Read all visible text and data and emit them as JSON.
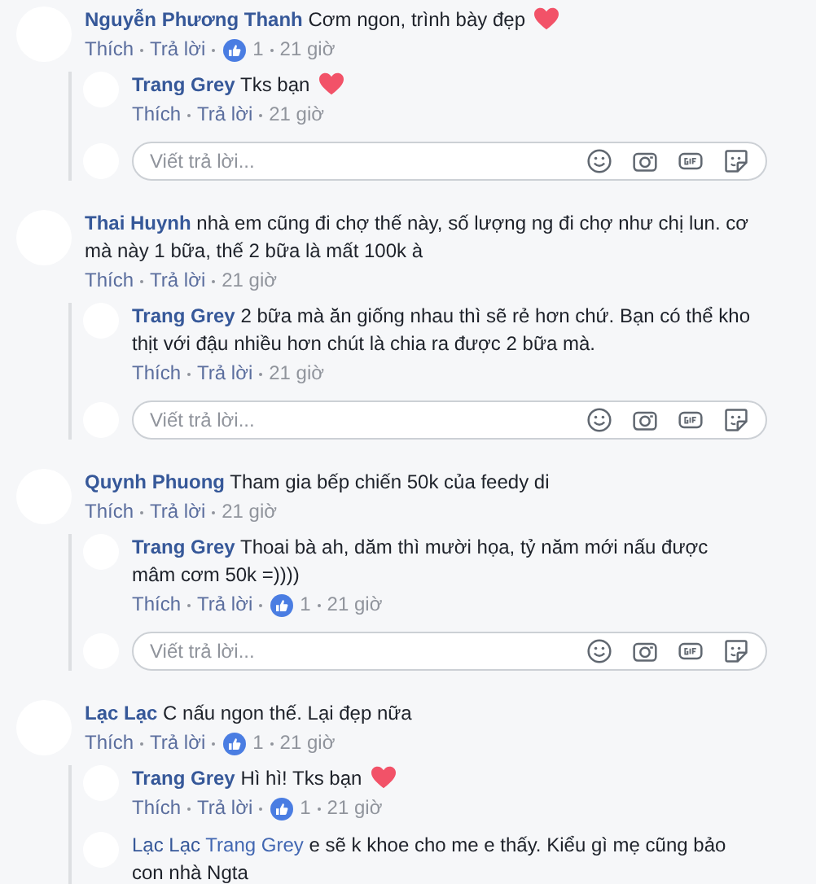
{
  "comments": [
    {
      "author": "Nguyễn Phương Thanh",
      "text": "Cơm ngon, trình bày đẹp",
      "heart": true,
      "like_label": "Thích",
      "reply_label": "Trả lời",
      "likes": "1",
      "time": "21 giờ",
      "replies": [
        {
          "author": "Trang Grey",
          "text": "Tks bạn",
          "heart": true,
          "like_label": "Thích",
          "reply_label": "Trả lời",
          "time": "21 giờ"
        }
      ],
      "reply_box": {
        "placeholder": "Viết trả lời..."
      }
    },
    {
      "author": "Thai Huynh",
      "text": "nhà em cũng đi chợ thế này, số lượng ng đi chợ như chị lun. cơ mà này 1 bữa, thế 2 bữa là mất 100k à",
      "heart": false,
      "like_label": "Thích",
      "reply_label": "Trả lời",
      "time": "21 giờ",
      "replies": [
        {
          "author": "Trang Grey",
          "text": "2 bữa mà ăn giống nhau thì sẽ rẻ hơn chứ. Bạn có thể kho thịt với đậu nhiều hơn chút là chia ra được 2 bữa mà.",
          "heart": false,
          "like_label": "Thích",
          "reply_label": "Trả lời",
          "time": "21 giờ"
        }
      ],
      "reply_box": {
        "placeholder": "Viết trả lời..."
      }
    },
    {
      "author": "Quynh Phuong",
      "text": "Tham gia bếp chiến 50k của feedy di",
      "heart": false,
      "like_label": "Thích",
      "reply_label": "Trả lời",
      "time": "21 giờ",
      "replies": [
        {
          "author": "Trang Grey",
          "text": "Thoai bà ah, dăm thì mười họa, tỷ năm mới nấu được mâm cơm 50k =))))",
          "heart": false,
          "like_label": "Thích",
          "reply_label": "Trả lời",
          "likes": "1",
          "time": "21 giờ"
        }
      ],
      "reply_box": {
        "placeholder": "Viết trả lời..."
      }
    },
    {
      "author": "Lạc Lạc",
      "text": "C nấu ngon thế. Lại đẹp nữa",
      "heart": false,
      "like_label": "Thích",
      "reply_label": "Trả lời",
      "likes": "1",
      "time": "21 giờ",
      "replies": [
        {
          "author": "Trang Grey",
          "text": "Hì hì! Tks bạn",
          "heart": true,
          "like_label": "Thích",
          "reply_label": "Trả lời",
          "likes": "1",
          "time": "21 giờ"
        },
        {
          "author": "Lạc Lạc",
          "mention": "Trang Grey",
          "text": "e sẽ k khoe cho me e thấy. Kiểu gì mẹ cũng bảo con nhà Ngta",
          "heart": false
        }
      ]
    }
  ]
}
